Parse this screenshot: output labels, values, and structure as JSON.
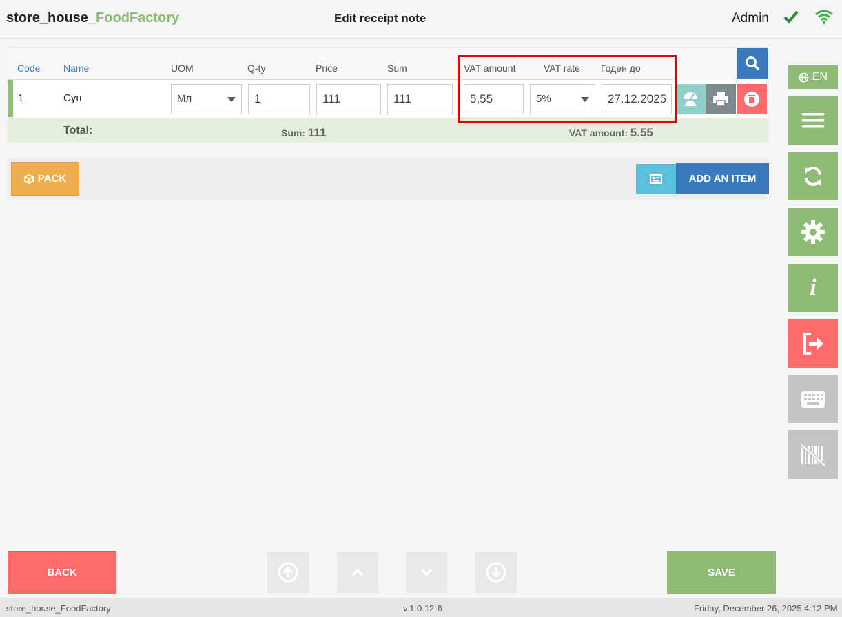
{
  "header": {
    "app_name_prefix": "store_house",
    "app_name_suffix": "_FoodFactory",
    "title": "Edit receipt note",
    "user": "Admin",
    "icons": [
      "check-icon",
      "wifi-icon"
    ]
  },
  "table": {
    "columns": {
      "code": "Code",
      "name": "Name",
      "uom": "UOM",
      "qty": "Q-ty",
      "price": "Price",
      "sum": "Sum",
      "vat_amount": "VAT amount",
      "vat_rate": "VAT rate",
      "expiry": "Годен до"
    },
    "rows": [
      {
        "code": "1",
        "name": "Суп",
        "uom": "Мл",
        "qty": "1",
        "price": "111",
        "sum": "111",
        "vat_amount": "5,55",
        "vat_rate": "5%",
        "expiry": "27.12.2025"
      }
    ],
    "totals": {
      "label": "Total:",
      "sum_label": "Sum:",
      "sum_value": "111",
      "vat_label": "VAT amount:",
      "vat_value": "5.55"
    }
  },
  "actions": {
    "pack": "PACK",
    "add_item": "ADD AN ITEM"
  },
  "sidebar": {
    "language": "EN",
    "items": [
      "menu-icon",
      "sync-icon",
      "settings-icon",
      "info-icon",
      "logout-icon",
      "keyboard-icon",
      "barcode-off-icon"
    ]
  },
  "footer": {
    "back": "BACK",
    "save": "SAVE"
  },
  "status": {
    "app": "store_house_FoodFactory",
    "version": "v.1.0.12-6",
    "datetime": "Friday, December 26, 2025 4:12 PM"
  },
  "colors": {
    "green": "#8dbb76",
    "blue": "#3a7bbf",
    "red": "#ff6b6b",
    "orange": "#f0ad4e",
    "cyan": "#5bc0de",
    "gray_btn": "#c4c4c4",
    "highlight": "#e60000"
  }
}
